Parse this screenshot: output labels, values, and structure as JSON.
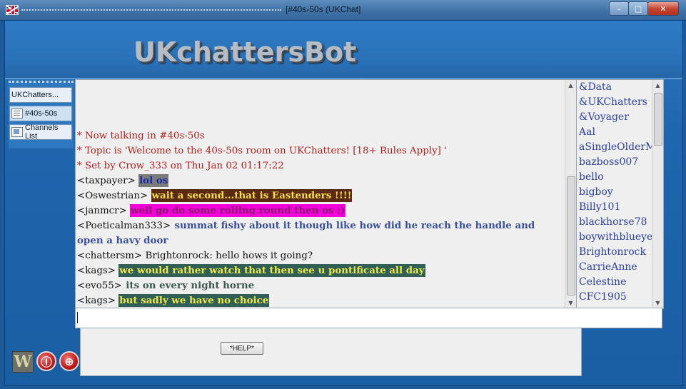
{
  "window": {
    "title": "[#40s-50s (UKChat]",
    "minimize_glyph": "–",
    "maximize_glyph": "□",
    "close_glyph": "✕"
  },
  "brand": {
    "name": "UKchattersBot"
  },
  "nav": {
    "items": [
      {
        "label": "UKChatters...",
        "icon": "chat-icon"
      },
      {
        "label": "#40s-50s",
        "icon": "room-icon"
      },
      {
        "label": "Channels List",
        "icon": "list-icon"
      }
    ]
  },
  "chat": {
    "lines": [
      {
        "prefix": "",
        "text": "* Now talking in #40s-50s",
        "kind": "system"
      },
      {
        "prefix": "",
        "text": "* Topic is 'Welcome to the 40s-50s room on UKChatters! [18+ Rules Apply] '",
        "kind": "system"
      },
      {
        "prefix": "",
        "text": "* Set by Crow_333 on Thu Jan 02 01:17:22",
        "kind": "system"
      },
      {
        "prefix": "<taxpayer>",
        "text": "lol os",
        "color": "#1a2aa8",
        "bg": "#7b7b7b"
      },
      {
        "prefix": "<Oswestrian>",
        "text": "wait a second...that is Eastenders !!!!",
        "color": "#f4e14a",
        "bg": "#5b2a12"
      },
      {
        "prefix": "<janmcr>",
        "text": "well go do some rolling round then os :)",
        "color": "#8a1e6e",
        "bg": "#f200d8"
      },
      {
        "prefix": "<Poeticalman333>",
        "text": "summat fishy about it though like how did he reach the handle and open a havy door",
        "color": "#3b4f9a",
        "bg": "",
        "wrap": true
      },
      {
        "prefix": "<chattersm>",
        "text": "Brightonrock: hello hows it going?",
        "color": "#111111",
        "bg": "",
        "plain": true
      },
      {
        "prefix": "<kags>",
        "text": "we would rather watch that then see u pontificate all day",
        "color": "#f0e84a",
        "bg": "#2f5f55"
      },
      {
        "prefix": "<evo55>",
        "text": "its on every night horne",
        "color": "#3e5a52",
        "bg": ""
      },
      {
        "prefix": "<kags>",
        "text": "but sadly we have no choice",
        "color": "#f0e84a",
        "bg": "#2f5f55"
      }
    ]
  },
  "users": [
    "&Data",
    "&UKChatters",
    "&Voyager",
    "Aal",
    "aSingleOlderM",
    "bazboss007",
    "bello",
    "bigboy",
    "Billy101",
    "blackhorse78",
    "boywithblueye",
    "Brightonrock",
    "CarrieAnne",
    "Celestine",
    "CFC1905"
  ],
  "input": {
    "value": ""
  },
  "help_button": {
    "label": "*HELP*"
  },
  "bottom_buttons": [
    {
      "label": "W",
      "icon": "w-icon"
    },
    {
      "label": "Ⓘ",
      "icon": "power-icon"
    },
    {
      "label": "⊕",
      "icon": "add-icon"
    }
  ],
  "colors": {
    "frame": "#1f66ae",
    "accent": "#2e78c0",
    "system_text": "#b01e1e",
    "user_list_text": "#2c3f9a"
  }
}
